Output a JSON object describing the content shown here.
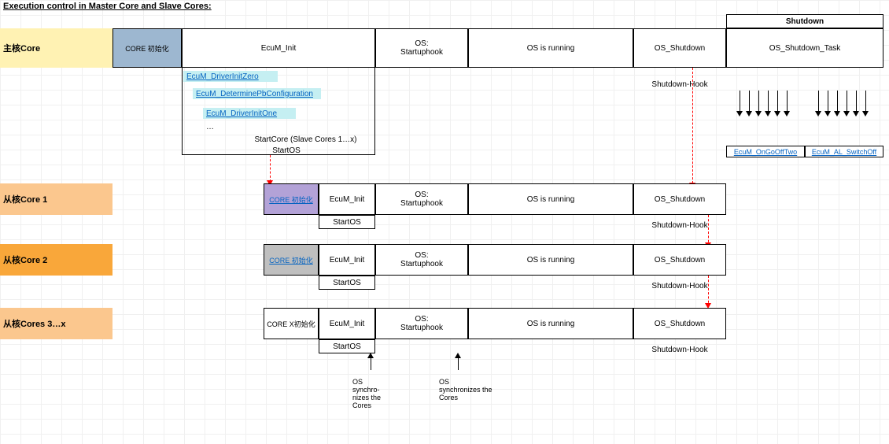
{
  "title": "Execution control in Master Core and Slave Cores:",
  "shutdown_header": "Shutdown",
  "rows": {
    "master": {
      "label": "主核Core",
      "core_init": "CORE 初始化",
      "ecum_init": "EcuM_Init",
      "os_startup": "OS:\nStartuphook",
      "os_running": "OS is running",
      "os_shutdown": "OS_Shutdown",
      "shutdown_task": "OS_Shutdown_Task",
      "shutdown_hook": "Shutdown-Hook"
    },
    "links": {
      "zero": "EcuM_DriverInitZero",
      "pb": "EcuM_DeterminePbConfiguration",
      "one": "EcuM_DriverInitOne",
      "dots": "…",
      "startcore": "StartCore (Slave Cores 1…x)",
      "startos": "StartOS"
    },
    "bottom_links": {
      "ongo": "EcuM_OnGoOffTwo",
      "switch": "EcuM_AL_SwitchOff"
    },
    "slave1": {
      "label": "从核Core 1",
      "core_init": "CORE 初始化",
      "ecum_init": "EcuM_Init",
      "os_startup": "OS:\nStartuphook",
      "os_running": "OS is running",
      "os_shutdown": "OS_Shutdown",
      "startos": "StartOS",
      "shutdown_hook": "Shutdown-Hook"
    },
    "slave2": {
      "label": "从核Core 2",
      "core_init": "CORE 初始化",
      "ecum_init": "EcuM_Init",
      "os_startup": "OS:\nStartuphook",
      "os_running": "OS is running",
      "os_shutdown": "OS_Shutdown",
      "startos": "StartOS",
      "shutdown_hook": "Shutdown-Hook"
    },
    "slave3": {
      "label": "从核Cores 3…x",
      "core_init": "CORE X初始化",
      "ecum_init": "EcuM_Init",
      "os_startup": "OS:\nStartuphook",
      "os_running": "OS is running",
      "os_shutdown": "OS_Shutdown",
      "startos": "StartOS",
      "shutdown_hook": "Shutdown-Hook"
    }
  },
  "notes": {
    "sync1": "OS\nsynchro-\nnizes the\nCores",
    "sync2": "OS\nsynchronizes the\nCores"
  }
}
